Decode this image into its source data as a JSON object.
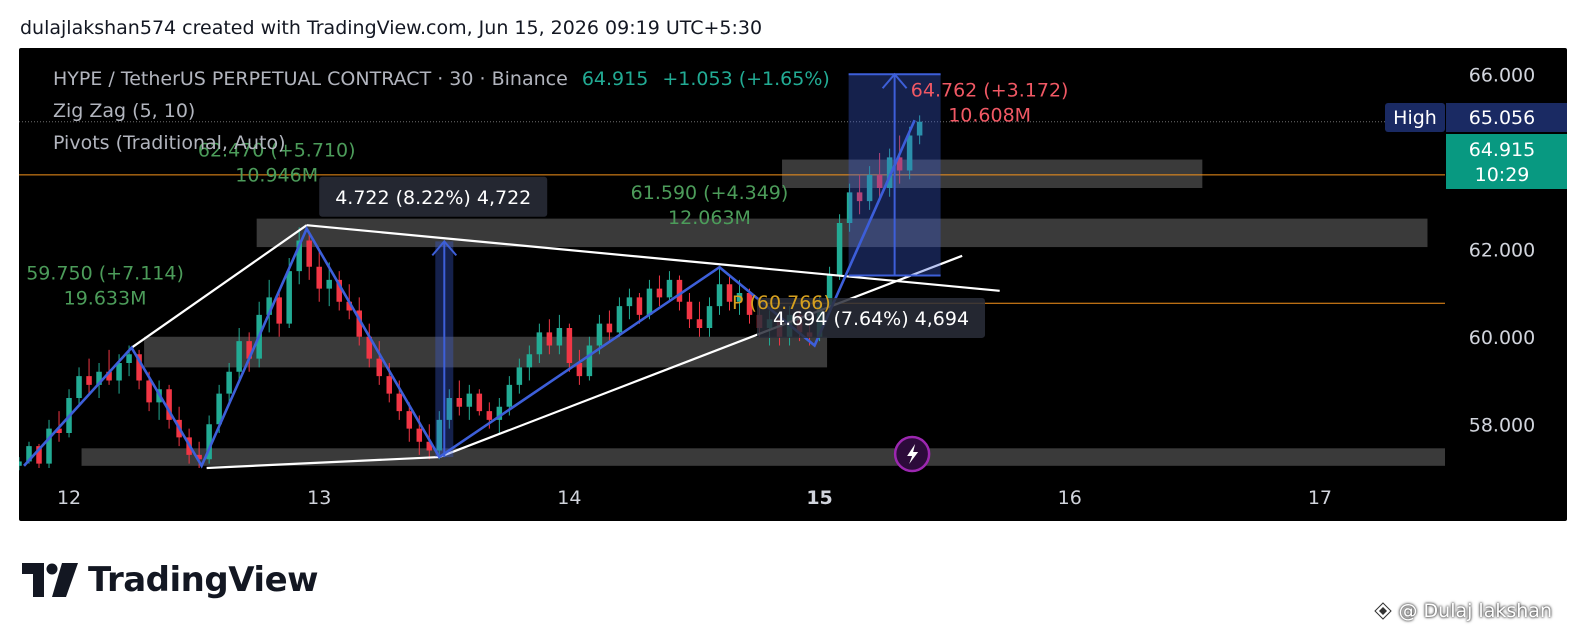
{
  "header": {
    "text": "dulajlakshan574 created with TradingView.com, Jun 15, 2026 09:19 UTC+5:30"
  },
  "legend": {
    "symbol": "HYPE / TetherUS PERPETUAL CONTRACT · 30 · Binance",
    "last": "64.915",
    "change": "+1.053 (+1.65%)",
    "indicator1": "Zig Zag (5, 10)",
    "indicator2": "Pivots (Traditional, Auto)"
  },
  "footer": {
    "brand": "TradingView",
    "credit": "@ Dulaj lakshan"
  },
  "colors": {
    "bg": "#000000",
    "up": "#22ab94",
    "down": "#f23645",
    "zigzag": "#3d5fd9",
    "trend": "#ffffff",
    "label_green": "#4c9c5a",
    "label_red": "#f05864",
    "pivot": "#d6a01f",
    "price_line": "#f7931a",
    "box": "#808080",
    "high_bg": "#1a2a63",
    "last_bg": "#089981"
  },
  "chart_data": {
    "type": "candlestick",
    "x_ticks": [
      "12",
      "13",
      "14",
      "15",
      "16",
      "17"
    ],
    "y_ticks": [
      "66.000",
      "64.000",
      "62.000",
      "60.000",
      "58.000"
    ],
    "ylim": [
      57.0,
      66.6
    ],
    "xlim": [
      11.8,
      17.5
    ],
    "last_price": {
      "label": "64.915",
      "value": 64.915,
      "countdown": "10:29"
    },
    "high_label": {
      "label": "High",
      "value_text": "65.056",
      "value": 65.056
    },
    "zigzag": [
      {
        "t": 11.82,
        "p": 57.05
      },
      {
        "t": 12.25,
        "p": 59.75
      },
      {
        "t": 12.53,
        "p": 57.05
      },
      {
        "t": 12.95,
        "p": 62.47
      },
      {
        "t": 13.48,
        "p": 57.25
      },
      {
        "t": 14.6,
        "p": 61.59
      },
      {
        "t": 14.98,
        "p": 59.8
      },
      {
        "t": 15.38,
        "p": 64.95
      }
    ],
    "zigzag_labels": [
      {
        "line1": "59.750 (+7.114)",
        "line2": "19.633M",
        "t": 12.2,
        "p": 59.75,
        "color": "green"
      },
      {
        "line1": "62.470 (+5.710)",
        "line2": "10.946M",
        "t": 12.95,
        "p": 62.47,
        "color": "green"
      },
      {
        "line1": "61.590 (+4.349)",
        "line2": "12.063M",
        "t": 14.6,
        "p": 61.59,
        "color": "green"
      },
      {
        "line1": "64.762 (+3.172)",
        "line2": "10.608M",
        "t": 15.38,
        "p": 64.76,
        "color": "red"
      }
    ],
    "trendlines": [
      {
        "t1": 12.25,
        "p1": 59.75,
        "t2": 12.95,
        "p2": 62.55
      },
      {
        "t1": 12.95,
        "p1": 62.55,
        "t2": 15.72,
        "p2": 61.05
      },
      {
        "t1": 12.55,
        "p1": 57.0,
        "t2": 13.48,
        "p2": 57.25
      },
      {
        "t1": 13.48,
        "p1": 57.25,
        "t2": 15.57,
        "p2": 61.85
      }
    ],
    "measures": [
      {
        "text": "4.722 (8.22%) 4,722",
        "t": 13.5,
        "p_from": 57.25,
        "p_to": 62.18,
        "label_t": 13.0,
        "label_p": 63.2
      },
      {
        "text": "4.694 (7.64%) 4,694",
        "t": 15.3,
        "p_from": 61.4,
        "p_to": 66.0,
        "label_t": 14.75,
        "label_p": 60.43
      }
    ],
    "pivot": {
      "label": "P (60.766)",
      "value": 60.766
    },
    "zones": [
      {
        "t1": 14.85,
        "t2": 16.53,
        "p_top": 64.05,
        "p_bot": 63.4
      },
      {
        "t1": 12.75,
        "t2": 17.43,
        "p_top": 62.7,
        "p_bot": 62.05
      },
      {
        "t1": 12.3,
        "t2": 15.03,
        "p_top": 60.0,
        "p_bot": 59.3
      },
      {
        "t1": 12.05,
        "t2": 17.5,
        "p_top": 57.45,
        "p_bot": 57.05
      }
    ],
    "candles": [
      [
        11.76,
        56.95,
        57.1,
        56.9,
        57.05
      ],
      [
        11.8,
        57.05,
        57.25,
        56.95,
        57.15
      ],
      [
        11.84,
        57.15,
        57.6,
        57.1,
        57.5
      ],
      [
        11.88,
        57.5,
        57.55,
        57.0,
        57.1
      ],
      [
        11.92,
        57.1,
        58.1,
        57.0,
        57.9
      ],
      [
        11.96,
        57.9,
        58.3,
        57.6,
        57.8
      ],
      [
        12.0,
        57.8,
        58.8,
        57.7,
        58.6
      ],
      [
        12.04,
        58.6,
        59.3,
        58.4,
        59.1
      ],
      [
        12.08,
        59.1,
        59.5,
        58.7,
        58.9
      ],
      [
        12.12,
        58.9,
        59.4,
        58.6,
        59.2
      ],
      [
        12.16,
        59.2,
        59.7,
        58.9,
        59.0
      ],
      [
        12.2,
        59.0,
        59.6,
        58.7,
        59.4
      ],
      [
        12.24,
        59.4,
        59.8,
        59.1,
        59.6
      ],
      [
        12.28,
        59.6,
        59.7,
        58.8,
        59.0
      ],
      [
        12.32,
        59.0,
        59.2,
        58.3,
        58.5
      ],
      [
        12.36,
        58.5,
        59.0,
        58.1,
        58.8
      ],
      [
        12.4,
        58.8,
        58.9,
        57.9,
        58.1
      ],
      [
        12.44,
        58.1,
        58.4,
        57.5,
        57.7
      ],
      [
        12.48,
        57.7,
        57.9,
        57.1,
        57.3
      ],
      [
        12.52,
        57.3,
        57.6,
        57.0,
        57.2
      ],
      [
        12.56,
        57.2,
        58.2,
        57.1,
        58.0
      ],
      [
        12.6,
        58.0,
        58.9,
        57.8,
        58.7
      ],
      [
        12.64,
        58.7,
        59.4,
        58.5,
        59.2
      ],
      [
        12.68,
        59.2,
        60.2,
        59.0,
        59.9
      ],
      [
        12.72,
        59.9,
        60.1,
        59.2,
        59.5
      ],
      [
        12.76,
        59.5,
        60.8,
        59.3,
        60.5
      ],
      [
        12.8,
        60.5,
        61.3,
        60.1,
        60.9
      ],
      [
        12.84,
        60.9,
        61.0,
        60.0,
        60.3
      ],
      [
        12.88,
        60.3,
        61.8,
        60.2,
        61.5
      ],
      [
        12.92,
        61.5,
        62.5,
        61.2,
        62.2
      ],
      [
        12.96,
        62.2,
        62.4,
        61.3,
        61.6
      ],
      [
        13.0,
        61.6,
        62.0,
        60.8,
        61.1
      ],
      [
        13.04,
        61.1,
        61.7,
        60.7,
        61.3
      ],
      [
        13.08,
        61.3,
        61.5,
        60.6,
        60.8
      ],
      [
        13.12,
        60.8,
        61.2,
        60.4,
        60.6
      ],
      [
        13.16,
        60.6,
        60.9,
        59.8,
        60.0
      ],
      [
        13.2,
        60.0,
        60.3,
        59.3,
        59.5
      ],
      [
        13.24,
        59.5,
        59.9,
        58.9,
        59.1
      ],
      [
        13.28,
        59.1,
        59.4,
        58.5,
        58.7
      ],
      [
        13.32,
        58.7,
        59.0,
        58.1,
        58.3
      ],
      [
        13.36,
        58.3,
        58.5,
        57.6,
        57.9
      ],
      [
        13.4,
        57.9,
        58.2,
        57.3,
        57.6
      ],
      [
        13.44,
        57.6,
        58.0,
        57.2,
        57.4
      ],
      [
        13.48,
        57.4,
        58.3,
        57.2,
        58.1
      ],
      [
        13.52,
        58.1,
        58.8,
        57.9,
        58.6
      ],
      [
        13.56,
        58.6,
        59.0,
        58.2,
        58.4
      ],
      [
        13.6,
        58.4,
        58.9,
        58.1,
        58.7
      ],
      [
        13.64,
        58.7,
        58.8,
        58.2,
        58.3
      ],
      [
        13.68,
        58.3,
        58.5,
        57.9,
        58.1
      ],
      [
        13.72,
        58.1,
        58.6,
        57.8,
        58.4
      ],
      [
        13.76,
        58.4,
        59.1,
        58.2,
        58.9
      ],
      [
        13.8,
        58.9,
        59.5,
        58.7,
        59.3
      ],
      [
        13.84,
        59.3,
        59.8,
        59.0,
        59.6
      ],
      [
        13.88,
        59.6,
        60.3,
        59.4,
        60.1
      ],
      [
        13.92,
        60.1,
        60.4,
        59.6,
        59.8
      ],
      [
        13.96,
        59.8,
        60.5,
        59.6,
        60.2
      ],
      [
        14.0,
        60.2,
        60.3,
        59.2,
        59.4
      ],
      [
        14.04,
        59.4,
        59.7,
        58.9,
        59.1
      ],
      [
        14.08,
        59.1,
        60.0,
        59.0,
        59.8
      ],
      [
        14.12,
        59.8,
        60.5,
        59.6,
        60.3
      ],
      [
        14.16,
        60.3,
        60.6,
        59.9,
        60.1
      ],
      [
        14.2,
        60.1,
        60.9,
        60.0,
        60.7
      ],
      [
        14.24,
        60.7,
        61.1,
        60.4,
        60.9
      ],
      [
        14.28,
        60.9,
        61.0,
        60.3,
        60.5
      ],
      [
        14.32,
        60.5,
        61.3,
        60.4,
        61.1
      ],
      [
        14.36,
        61.1,
        61.4,
        60.7,
        60.9
      ],
      [
        14.4,
        60.9,
        61.5,
        60.8,
        61.3
      ],
      [
        14.44,
        61.3,
        61.4,
        60.6,
        60.8
      ],
      [
        14.48,
        60.8,
        61.0,
        60.2,
        60.4
      ],
      [
        14.52,
        60.4,
        60.8,
        60.0,
        60.2
      ],
      [
        14.56,
        60.2,
        60.9,
        60.0,
        60.7
      ],
      [
        14.6,
        60.7,
        61.6,
        60.5,
        61.2
      ],
      [
        14.64,
        61.2,
        61.4,
        60.6,
        60.8
      ],
      [
        14.68,
        60.8,
        61.3,
        60.5,
        61.0
      ],
      [
        14.72,
        61.0,
        61.1,
        60.3,
        60.5
      ],
      [
        14.76,
        60.5,
        60.8,
        60.0,
        60.2
      ],
      [
        14.8,
        60.2,
        60.6,
        59.8,
        60.4
      ],
      [
        14.84,
        60.4,
        60.5,
        59.8,
        60.0
      ],
      [
        14.88,
        60.0,
        60.7,
        59.8,
        60.5
      ],
      [
        14.92,
        60.5,
        60.6,
        59.9,
        60.1
      ],
      [
        14.96,
        60.1,
        60.3,
        59.8,
        60.0
      ],
      [
        15.0,
        60.0,
        60.9,
        59.9,
        60.7
      ],
      [
        15.04,
        60.7,
        61.6,
        60.6,
        61.4
      ],
      [
        15.08,
        61.4,
        62.8,
        61.3,
        62.6
      ],
      [
        15.12,
        62.6,
        63.5,
        62.4,
        63.3
      ],
      [
        15.16,
        63.3,
        63.7,
        62.8,
        63.1
      ],
      [
        15.2,
        63.1,
        63.9,
        62.9,
        63.7
      ],
      [
        15.24,
        63.7,
        64.2,
        63.1,
        63.4
      ],
      [
        15.28,
        63.4,
        64.3,
        63.2,
        64.1
      ],
      [
        15.32,
        64.1,
        64.6,
        63.5,
        63.8
      ],
      [
        15.36,
        63.8,
        64.8,
        63.6,
        64.6
      ],
      [
        15.4,
        64.6,
        65.06,
        64.4,
        64.915
      ]
    ]
  }
}
